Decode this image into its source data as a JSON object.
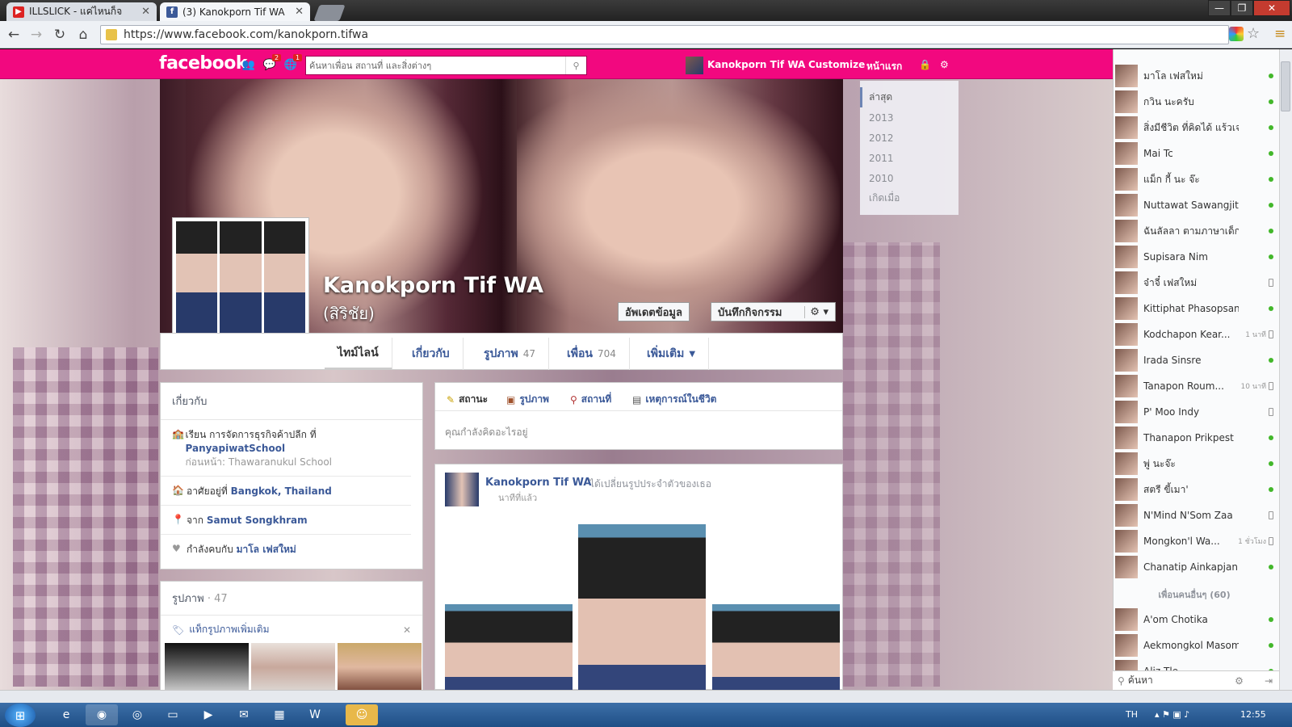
{
  "browser": {
    "tabs": [
      {
        "title": "ILLSLICK - แค่ไหนก็จ",
        "icon": "youtube-icon"
      },
      {
        "title": "(3) Kanokporn Tif WA",
        "icon": "facebook-icon"
      }
    ],
    "url": "https://www.facebook.com/kanokporn.tifwa"
  },
  "fb": {
    "logo": "facebook",
    "badges": {
      "messages": "2",
      "notifications": "1"
    },
    "search_placeholder": "ค้นหาเพื่อน สถานที่ และสิ่งต่างๆ",
    "profile_link": "Kanokporn Tif WA",
    "customize": "Customize",
    "home": "หน้าแรก"
  },
  "profile": {
    "name": "Kanokporn Tif WA",
    "alt_name": "(สิริชัย)",
    "update_info": "อัพเดตข้อมูล",
    "activity_log": "บันทึกกิจกรรม"
  },
  "timeline_years": [
    "ล่าสุด",
    "2013",
    "2012",
    "2011",
    "2010",
    "เกิดเมื่อ"
  ],
  "tabs": [
    {
      "label": "ไทม์ไลน์",
      "count": ""
    },
    {
      "label": "เกี่ยวกับ",
      "count": ""
    },
    {
      "label": "รูปภาพ",
      "count": "47"
    },
    {
      "label": "เพื่อน",
      "count": "704"
    },
    {
      "label": "เพิ่มเติม",
      "count": ""
    }
  ],
  "about": {
    "title": "เกี่ยวกับ",
    "school_prefix": "เรียน การจัดการธุรกิจค้าปลีก ที่",
    "school": "PanyapiwatSchool",
    "school_prev": "ก่อนหน้า: Thawaranukul School",
    "lives_prefix": "อาศัยอยู่ที่",
    "lives": "Bangkok, Thailand",
    "from_prefix": "จาก",
    "from": "Samut Songkhram",
    "rel_prefix": "กำลังคบกับ",
    "rel": "มาโล เฟสใหม่"
  },
  "photos": {
    "title": "รูปภาพ",
    "count": "· 47",
    "tag": "แท็กรูปภาพเพิ่มเติม"
  },
  "composer": {
    "tabs": [
      "สถานะ",
      "รูปภาพ",
      "สถานที่",
      "เหตุการณ์ในชีวิต"
    ],
    "placeholder": "คุณกำลังคิดอะไรอยู่"
  },
  "post": {
    "author": "Kanokporn Tif WA",
    "action": "ได้เปลี่ยนรูปประจำตัวของเธอ",
    "time": "นาทีที่แล้ว"
  },
  "chat": {
    "friends": [
      {
        "name": "มาโล เฟสใหม่",
        "status": "online",
        "ago": ""
      },
      {
        "name": "กวิน นะครับ",
        "status": "online",
        "ago": ""
      },
      {
        "name": "สิ่งมีชีวิต ที่คิดได้ แร้วเจ...",
        "status": "online",
        "ago": ""
      },
      {
        "name": "Mai Tc",
        "status": "online",
        "ago": ""
      },
      {
        "name": "แม็ก กี้ นะ จ๊ะ",
        "status": "online",
        "ago": ""
      },
      {
        "name": "Nuttawat Sawangjit",
        "status": "online",
        "ago": ""
      },
      {
        "name": "ฉันลัลลา ตามภาษาเด็ก",
        "status": "online",
        "ago": ""
      },
      {
        "name": "Supisara Nim",
        "status": "online",
        "ago": ""
      },
      {
        "name": "จ๋าจี๋ เฟสใหม่",
        "status": "mobile",
        "ago": ""
      },
      {
        "name": "Kittiphat Phasopsang",
        "status": "online",
        "ago": ""
      },
      {
        "name": "Kodchapon Kear...",
        "status": "mobile",
        "ago": "1 นาที"
      },
      {
        "name": "Irada Sinsre",
        "status": "online",
        "ago": ""
      },
      {
        "name": "Tanapon Roum...",
        "status": "mobile",
        "ago": "10 นาที"
      },
      {
        "name": "P' Moo Indy",
        "status": "mobile",
        "ago": ""
      },
      {
        "name": "Thanapon Prikpest",
        "status": "online",
        "ago": ""
      },
      {
        "name": "พู่ นะจ๊ะ",
        "status": "online",
        "ago": ""
      },
      {
        "name": "สตรี ขี้เมา'",
        "status": "online",
        "ago": ""
      },
      {
        "name": "N'Mind N'Som Zaa",
        "status": "mobile",
        "ago": ""
      },
      {
        "name": "Mongkon'l Wa...",
        "status": "mobile",
        "ago": "1 ชั่วโมง"
      },
      {
        "name": "Chanatip Ainkapjan",
        "status": "online",
        "ago": ""
      }
    ],
    "more_label": "เพื่อนคนอื่นๆ (60)",
    "more_friends": [
      {
        "name": "A'om Chotika",
        "status": "online",
        "ago": ""
      },
      {
        "name": "Aekmongkol Masomp...",
        "status": "online",
        "ago": ""
      },
      {
        "name": "Aliz Tle",
        "status": "online",
        "ago": ""
      }
    ],
    "search_label": "ค้นหา"
  },
  "taskbar": {
    "lang": "TH",
    "clock": "12:55"
  }
}
